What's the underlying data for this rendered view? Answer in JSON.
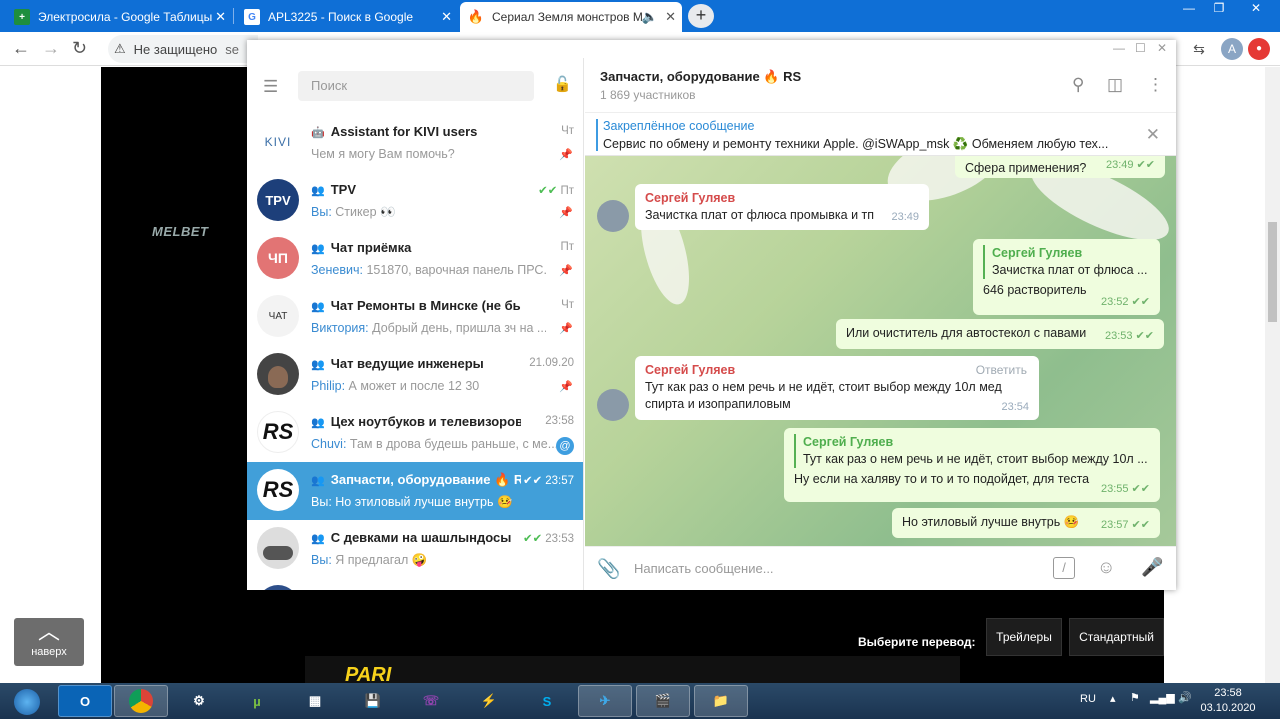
{
  "browser": {
    "tabs": [
      {
        "title": "Электросила - Google Таблицы",
        "icon": "sheets-icon",
        "active": false
      },
      {
        "title": "APL3225 - Поиск в Google",
        "icon": "google-icon",
        "active": false
      },
      {
        "title": "Сериал Земля монстров М",
        "icon": "fire-icon",
        "active": true
      }
    ],
    "address_security": "Не защищено",
    "address_text": "se",
    "profile_letter": "A",
    "colors": {
      "tabstrip": "#0f6fd6"
    }
  },
  "page": {
    "up_button": "наверх",
    "melbet_text": "MELBET",
    "translation_label": "Выберите перевод:",
    "translation_options": [
      "Трейлеры",
      "Стандартный"
    ],
    "banner_text": "PARI"
  },
  "telegram": {
    "search_placeholder": "Поиск",
    "chats": [
      {
        "name": "Assistant for KIVI users",
        "type": "bot",
        "preview_who": "",
        "preview": "Чем я могу Вам помочь?",
        "time": "Чт",
        "pinned": true,
        "avatar": "KIVI",
        "avatar_bg": "#ffffff"
      },
      {
        "name": "TPV",
        "type": "group",
        "preview_who": "Вы:",
        "preview": " Стикер 👀",
        "time": "Пт",
        "read": true,
        "pinned": true,
        "avatar": "TPV",
        "avatar_bg": "#1d3f7a"
      },
      {
        "name": "Чат приёмка",
        "type": "group",
        "preview_who": "Зеневич:",
        "preview": " 151870, варочная панель ПРС...",
        "time": "Пт",
        "pinned": true,
        "avatar": "ЧП",
        "avatar_bg": "#e27474"
      },
      {
        "name": "Чат Ремонты в Минске (не быт)",
        "type": "group",
        "preview_who": "Виктория:",
        "preview": " Добрый день, пришла зч на ...",
        "time": "Чт",
        "pinned": true,
        "avatar": "ЧАТ",
        "avatar_bg": "#f3f3f3"
      },
      {
        "name": "Чат ведущие инженеры",
        "type": "group",
        "preview_who": "Philip:",
        "preview": " А может и после 12 30",
        "time": "21.09.20",
        "pinned": true,
        "avatar": "",
        "avatar_bg": "#444444"
      },
      {
        "name": "Цех ноутбуков и телевизоров ...",
        "type": "group",
        "preview_who": "Chuvi:",
        "preview": " Там в дрова  будешь раньше, с ме...",
        "time": "23:58",
        "mention": "@",
        "avatar": "RS",
        "avatar_bg": "#ffffff"
      },
      {
        "name": "Запчасти, оборудование 🔥 RS",
        "type": "group",
        "preview_who": "Вы:",
        "preview": " Но этиловый лучше внутрь 🤒",
        "time": "23:57",
        "read": true,
        "active": true,
        "avatar": "RS",
        "avatar_bg": "#ffffff"
      },
      {
        "name": "С девками на шашлындосы",
        "type": "group",
        "preview_who": "Вы:",
        "preview": " Я предлагал 🤪",
        "time": "23:53",
        "read": true,
        "avatar": "",
        "avatar_bg": "#dddddd"
      }
    ],
    "chat": {
      "title": "Запчасти, оборудование 🔥 RS",
      "members": "1 869 участников",
      "pinned_title": "Закреплённое сообщение",
      "pinned_text": "Сервис по обмену и ремонту техники Apple. @iSWApp_msk  ♻️ Обменяем любую тех...",
      "messages": [
        {
          "dir": "out",
          "text": "Сфера применения?",
          "time": "23:49"
        },
        {
          "dir": "in",
          "sender": "Сергей Гуляев",
          "text": "Зачистка плат от флюса промывка и тп",
          "time": "23:49"
        },
        {
          "dir": "out",
          "reply_name": "Сергей Гуляев",
          "reply_text": "Зачистка плат от флюса ...",
          "text": "646 растворитель",
          "time": "23:52"
        },
        {
          "dir": "out",
          "text": "Или очиститель для автостекол с павами",
          "time": "23:53"
        },
        {
          "dir": "in",
          "sender": "Сергей Гуляев",
          "answer": "Ответить",
          "text": "Тут как раз о нем речь и не идёт, стоит выбор между 10л мед спирта и изопрапиловым",
          "time": "23:54"
        },
        {
          "dir": "out",
          "reply_name": "Сергей Гуляев",
          "reply_text": "Тут как раз о нем речь и не идёт, стоит выбор между 10л ...",
          "text": "Ну если на халяву то и  то и то подойдет, для теста",
          "time": "23:55"
        },
        {
          "dir": "out",
          "text": "Но этиловый лучше внутрь 🤒",
          "time": "23:57"
        }
      ],
      "compose_placeholder": "Написать сообщение..."
    }
  },
  "taskbar": {
    "lang": "RU",
    "time": "23:58",
    "date": "03.10.2020"
  }
}
